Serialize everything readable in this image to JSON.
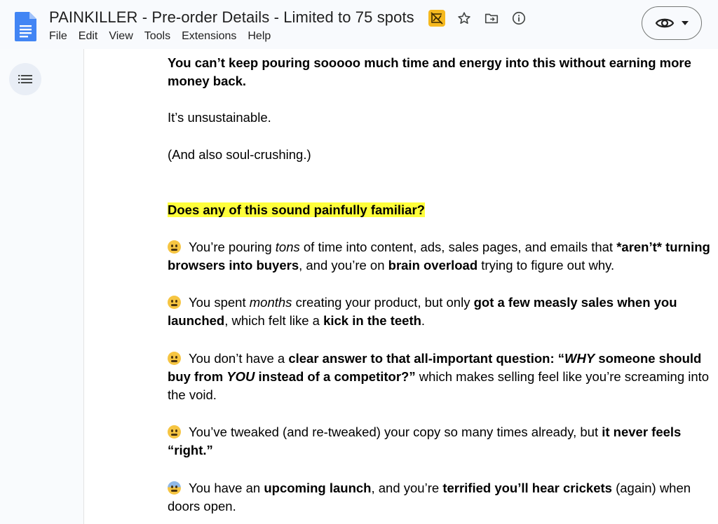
{
  "header": {
    "title": "PAINKILLER - Pre-order Details - Limited to 75 spots",
    "menu": [
      "File",
      "Edit",
      "View",
      "Tools",
      "Extensions",
      "Help"
    ]
  },
  "colors": {
    "highlight": "#ffff3b",
    "docs_blue": "#4285f4",
    "header_bg": "#f8fafd"
  },
  "icons": [
    "docs-logo-icon",
    "badge-icon",
    "star-icon",
    "move-folder-icon",
    "info-icon",
    "eye-icon",
    "caret-down-icon",
    "outline-list-icon"
  ],
  "doc": {
    "p1": "You can’t keep pouring sooooo much time and energy into this without earning more money back.",
    "p2": "It’s unsustainable.",
    "p3": "(And also soul-crushing.)",
    "heading": "Does any of this sound painfully familiar?",
    "b1": {
      "t1": "You’re pouring ",
      "i1": "tons",
      "t2": " of time into content, ads, sales pages, and emails that ",
      "s1": "*aren’t* turning browsers into buyers",
      "t3": ", and you’re on ",
      "s2": "brain overload",
      "t4": " trying to figure out why."
    },
    "b2": {
      "t1": "You spent ",
      "i1": "months",
      "t2": " creating your product, but only ",
      "s1": "got a few measly sales when you launched",
      "t3": ", which felt like a ",
      "s2": "kick in the teeth",
      "t4": "."
    },
    "b3": {
      "t1": "You don’t have a ",
      "s1": "clear answer to that all-important question: “",
      "s2": "WHY",
      "s3": " someone should buy from ",
      "s4": "YOU",
      "s5": " instead of a competitor?”",
      "t2": " which makes selling feel like you’re screaming into the void."
    },
    "b4": {
      "t1": "You’ve tweaked (and re-tweaked) your copy so many times already, but ",
      "s1": "it never feels “right.”"
    },
    "b5": {
      "t1": "You have an ",
      "s1": "upcoming launch",
      "t2": ", and you’re ",
      "s2": "terrified you’ll hear crickets",
      "t3": " (again) when doors open."
    }
  }
}
